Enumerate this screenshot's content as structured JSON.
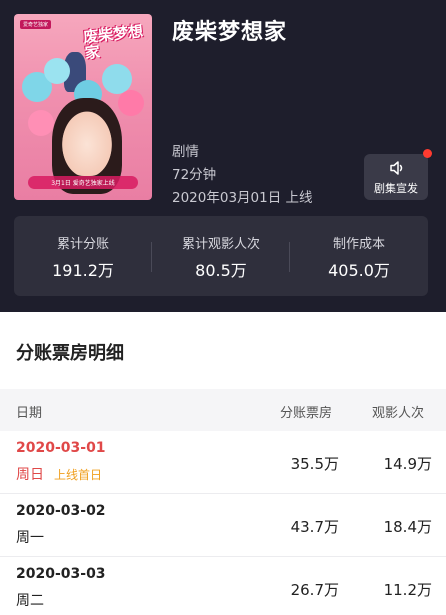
{
  "movie": {
    "title": "废柴梦想家",
    "genre": "剧情",
    "duration": "72分钟",
    "release_date": "2020年03月01日 上线",
    "poster": {
      "tag": "爱奇艺独家",
      "title": "废柴梦想家",
      "release_text": "3月1日 爱奇艺独家上线"
    }
  },
  "promo_button": {
    "label": "剧集宣发",
    "icon": "volume-icon"
  },
  "stats": [
    {
      "label": "累计分账",
      "value": "191.2万"
    },
    {
      "label": "累计观影人次",
      "value": "80.5万"
    },
    {
      "label": "制作成本",
      "value": "405.0万"
    }
  ],
  "section": {
    "title": "分账票房明细"
  },
  "table": {
    "headers": {
      "date": "日期",
      "revenue": "分账票房",
      "audience": "观影人次"
    },
    "rows": [
      {
        "date": "2020-03-01",
        "weekday": "周日",
        "badge": "上线首日",
        "revenue": "35.5万",
        "audience": "14.9万"
      },
      {
        "date": "2020-03-02",
        "weekday": "周一",
        "revenue": "43.7万",
        "audience": "18.4万"
      },
      {
        "date": "2020-03-03",
        "weekday": "周二",
        "revenue": "26.7万",
        "audience": "11.2万"
      }
    ]
  },
  "colors": {
    "header_bg": "#1e1e2c",
    "stats_bg": "#2f2f3c",
    "first_day_accent": "#e04848",
    "badge_accent": "#f0a020",
    "notification_dot": "#ff3b30"
  }
}
